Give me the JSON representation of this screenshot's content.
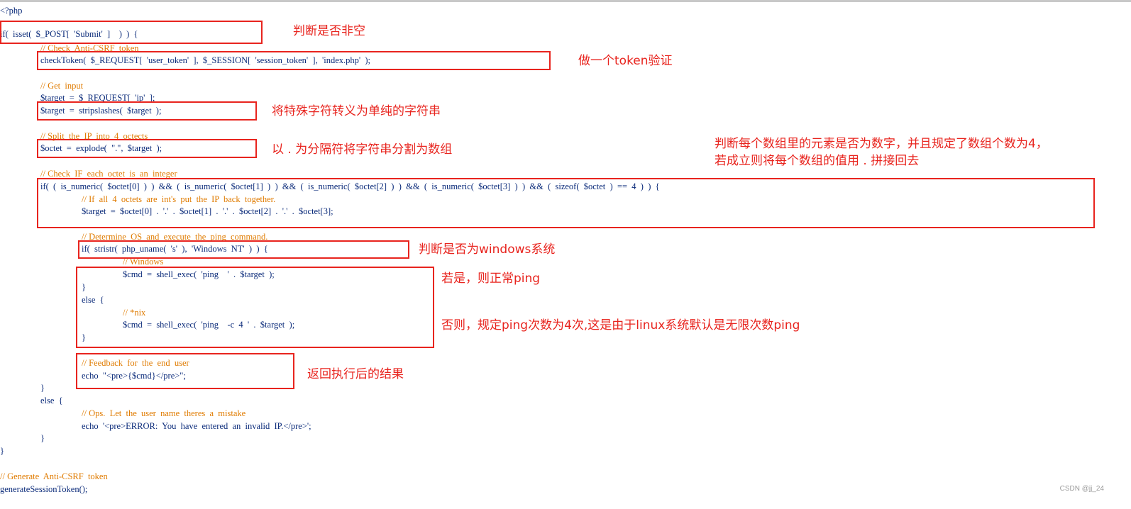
{
  "code_lines": [
    "<?php",
    "if(  isset(  $_POST[  'Submit'  ]    )  )  {",
    "// Check  Anti-CSRF  token",
    "checkToken(  $_REQUEST[  'user_token'  ],  $_SESSION[  'session_token'  ],  'index.php'  );",
    "// Get  input",
    "$target  =  $_REQUEST[  'ip'  ];",
    "$target  =  stripslashes(  $target  );",
    "// Split  the  IP  into  4  octects",
    "$octet  =  explode(  \".\",  $target  );",
    "// Check  IF  each  octet  is  an  integer",
    "if(  (  is_numeric(  $octet[0]  )  )  &&  (  is_numeric(  $octet[1]  )  )  &&  (  is_numeric(  $octet[2]  )  )  &&  (  is_numeric(  $octet[3]  )  )  &&  (  sizeof(  $octet  )  ==  4  )  )  {",
    "// If  all  4  octets  are  int's  put  the  IP  back  together.",
    "$target  =  $octet[0]  .  '.'  .  $octet[1]  .  '.'  .  $octet[2]  .  '.'  .  $octet[3];",
    "// Determine  OS  and  execute  the  ping  command.",
    "if(  stristr(  php_uname(  's'  ),  'Windows  NT'  )  )  {",
    "// Windows",
    "$cmd  =  shell_exec(  'ping    '  .  $target  );",
    "}",
    "else  {",
    "// *nix",
    "$cmd  =  shell_exec(  'ping    -c  4  '  .  $target  );",
    "}",
    "// Feedback  for  the  end  user",
    "echo  \"<pre>{$cmd}</pre>\";",
    "}",
    "else  {",
    "// Ops.  Let  the  user  name  theres  a  mistake",
    "echo  '<pre>ERROR:  You  have  entered  an  invalid  IP.</pre>';",
    "}",
    "}",
    "// Generate  Anti-CSRF  token",
    "generateSessionToken();"
  ],
  "annotations": {
    "not_empty": "判断是否非空",
    "token_check": "做一个token验证",
    "strip": "将特殊字符转义为单纯的字符串",
    "explode": "以 . 为分隔符将字符串分割为数组",
    "numeric_line1": "判断每个数组里的元素是否为数字，并且规定了数组个数为4，",
    "numeric_line2": "若成立则将每个数组的值用 . 拼接回去",
    "windows_check": "判断是否为windows系统",
    "windows_ping": "若是，则正常ping",
    "nix_ping": "否则，规定ping次数为4次,这是由于linux系统默认是无限次数ping",
    "feedback": "返回执行后的结果"
  },
  "colors": {
    "code": "#0b2b7a",
    "comment": "#e07b00",
    "annotation": "#e8241e"
  },
  "watermark": "CSDN @jj_24"
}
